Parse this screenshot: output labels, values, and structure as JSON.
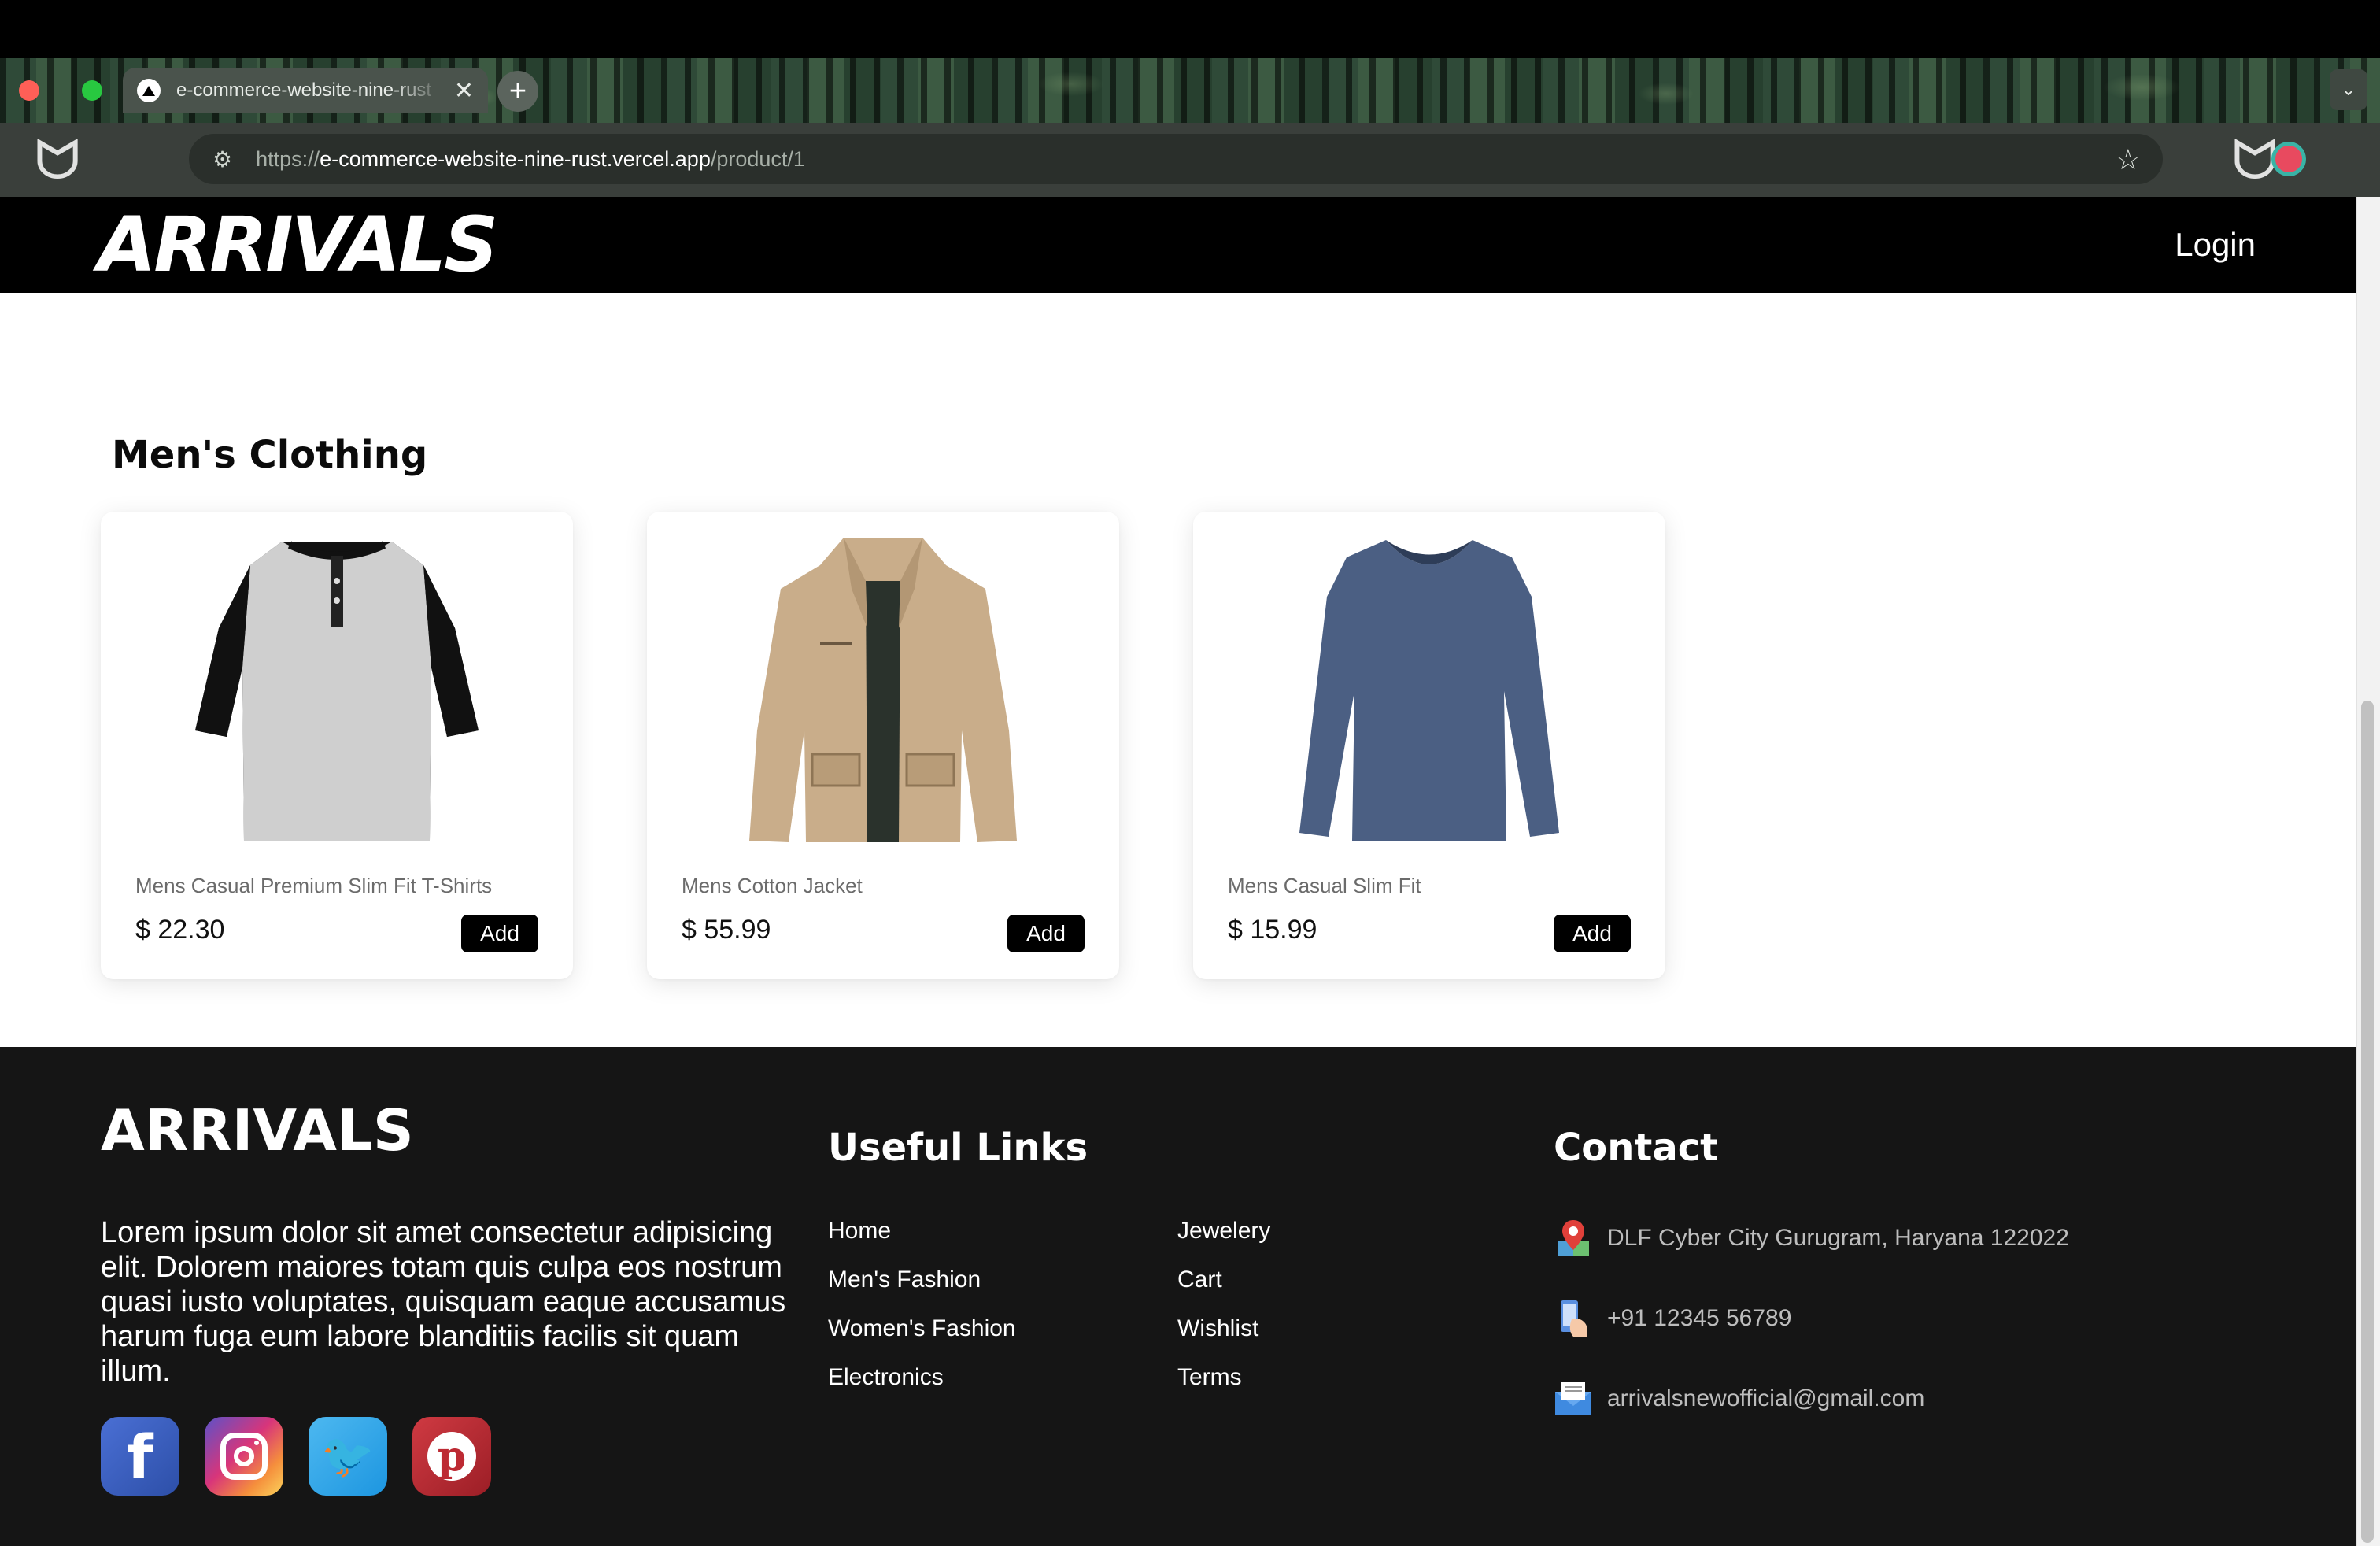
{
  "browser": {
    "tab_title": "e-commerce-website-nine-rust",
    "url_scheme": "https://",
    "url_host": "e-commerce-website-nine-rust.vercel.app",
    "url_path": "/product/1",
    "new_tab_label": "+",
    "tab_close_label": "✕",
    "tab_menu_label": "⌄"
  },
  "header": {
    "brand": "ARRIVALS",
    "login_label": "Login"
  },
  "section": {
    "title": "Men's Clothing"
  },
  "products": [
    {
      "name": "Mens Casual Premium Slim Fit T-Shirts",
      "price": "$ 22.30",
      "add_label": "Add",
      "image": "raglan-henley-shirt"
    },
    {
      "name": "Mens Cotton Jacket",
      "price": "$ 55.99",
      "add_label": "Add",
      "image": "khaki-cotton-jacket"
    },
    {
      "name": "Mens Casual Slim Fit",
      "price": "$ 15.99",
      "add_label": "Add",
      "image": "blue-long-sleeve-tee"
    }
  ],
  "footer": {
    "brand": "ARRIVALS",
    "about": "Lorem ipsum dolor sit amet consectetur adipisicing elit. Dolorem maiores totam quis culpa eos nostrum quasi iusto voluptates, quisquam eaque accusamus harum fuga eum labore blanditiis facilis sit quam illum.",
    "social": [
      "facebook-icon",
      "instagram-icon",
      "twitter-icon",
      "pinterest-icon"
    ],
    "links_heading": "Useful Links",
    "links_col1": [
      "Home",
      "Men's Fashion",
      "Women's Fashion",
      "Electronics"
    ],
    "links_col2": [
      "Jewelery",
      "Cart",
      "Wishlist",
      "Terms"
    ],
    "contact_heading": "Contact",
    "address": "DLF Cyber City Gurugram, Haryana 122022",
    "phone": "+91 12345 56789",
    "email": "arrivalsnewofficial@gmail.com"
  },
  "colors": {
    "header_bg": "#000000",
    "footer_bg": "#151515",
    "button_bg": "#000000"
  }
}
